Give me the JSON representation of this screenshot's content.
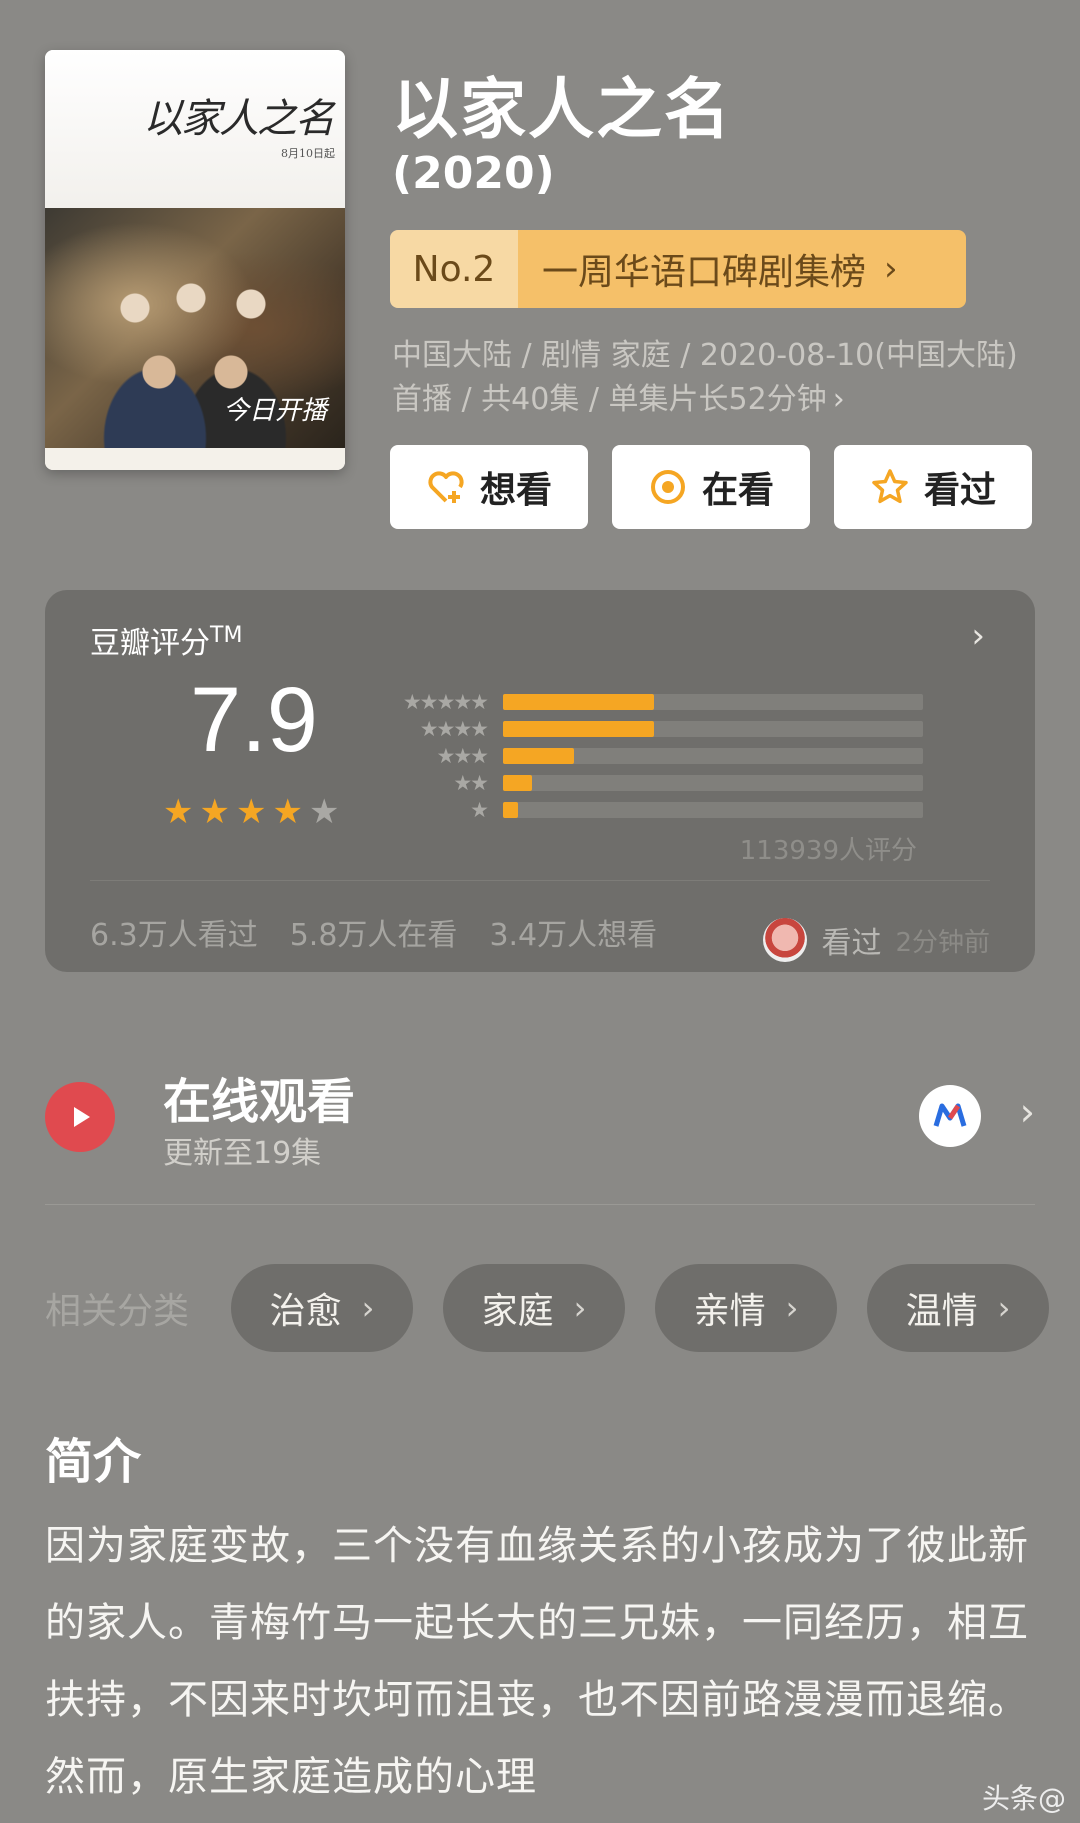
{
  "header": {
    "title": "以家人之名",
    "year": "(2020)",
    "rank": {
      "no": "No.2",
      "label": "一周华语口碑剧集榜",
      "chevron": "›"
    },
    "meta": "中国大陆 / 剧情 家庭 / 2020-08-10(中国大陆)首播 / 共40集 / 单集片长52分钟",
    "meta_chevron": "›",
    "poster": {
      "title_art": "以家人之名",
      "date_art": "8月10日起",
      "sign_art": "今日开播"
    }
  },
  "actions": {
    "want": "想看",
    "watching": "在看",
    "watched": "看过",
    "accent": "#f5a623"
  },
  "rating": {
    "label": "豆瓣评分",
    "tm": "TM",
    "chevron": "›",
    "score": "7.9",
    "stars_filled": 4,
    "stars_total": 5,
    "distribution": [
      {
        "stars": "★★★★★",
        "fraction": 0.36
      },
      {
        "stars": "★★★★",
        "fraction": 0.36
      },
      {
        "stars": "★★★",
        "fraction": 0.17
      },
      {
        "stars": "★★",
        "fraction": 0.07
      },
      {
        "stars": "★",
        "fraction": 0.035
      }
    ],
    "count": "113939人评分",
    "stats": [
      "6.3万人看过",
      "5.8万人在看",
      "3.4万人想看"
    ],
    "recent": {
      "action": "看过",
      "time": "2分钟前"
    },
    "bar_color": "#f5a623"
  },
  "watch": {
    "title": "在线观看",
    "subtitle": "更新至19集",
    "chevron": "›",
    "play_color": "#e04a4f"
  },
  "categories": {
    "label": "相关分类",
    "items": [
      "治愈",
      "家庭",
      "亲情",
      "温情"
    ],
    "chevron": "›"
  },
  "intro": {
    "title": "简介",
    "body": "因为家庭变故，三个没有血缘关系的小孩成为了彼此新的家人。青梅竹马一起长大的三兄妹，一同经历，相互扶持，不因来时坎坷而沮丧，也不因前路漫漫而退缩。然而，原生家庭造成的心理"
  },
  "watermark": "头条@"
}
